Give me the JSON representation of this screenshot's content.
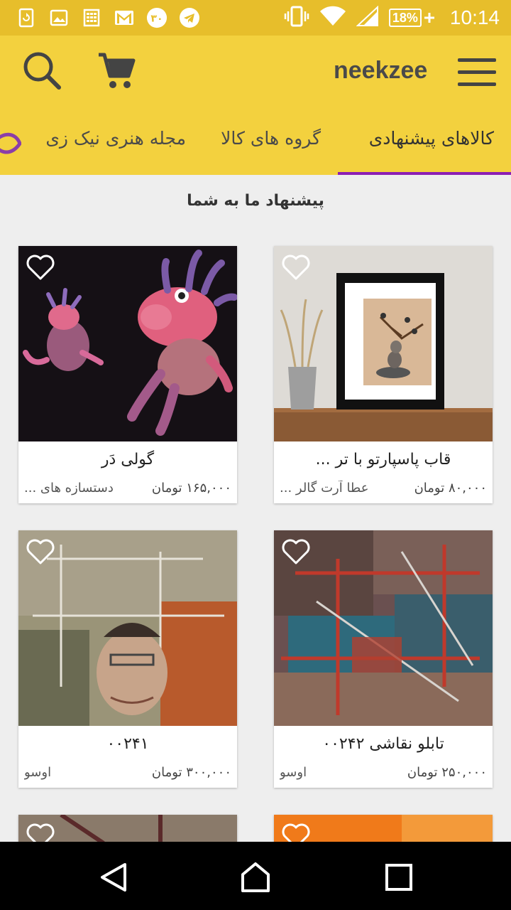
{
  "status_bar": {
    "time": "10:14",
    "battery": "18%",
    "notification_badge": "۳۰",
    "left_icons": [
      "sim-refresh-icon",
      "image-icon",
      "calculator-icon",
      "gmail-icon",
      "badge-icon",
      "telegram-icon"
    ],
    "right_icons": [
      "vibrate-icon",
      "wifi-icon",
      "signal-icon",
      "battery-icon"
    ]
  },
  "app_bar": {
    "brand": "neekzee",
    "icons": [
      "search-icon",
      "cart-icon",
      "menu-icon"
    ],
    "color": "#f3d13e"
  },
  "tabs": {
    "items": [
      {
        "label": "کالاهای پیشنهادی",
        "active": true
      },
      {
        "label": "گروه های کالا",
        "active": false
      },
      {
        "label": "مجله هنری نیک زی",
        "active": false
      }
    ],
    "active_color": "#8b1fb3"
  },
  "section_title": "پیشنهاد ما به شما",
  "products": [
    {
      "name": "قاب پاسپارتو با تر ...",
      "price": "۸۰,۰۰۰ تومان",
      "shop": "عطا آرت گالر ..."
    },
    {
      "name": "گولی دَر",
      "price": "۱۶۵,۰۰۰ تومان",
      "shop": "دستسازه های ..."
    },
    {
      "name": "تابلو نقاشی ۰۰۲۴۲",
      "price": "۲۵۰,۰۰۰ تومان",
      "shop": "اوسو"
    },
    {
      "name": "۰۰۲۴۱",
      "price": "۳۰۰,۰۰۰ تومان",
      "shop": "اوسو"
    }
  ],
  "nav_bar": {
    "icons": [
      "back-icon",
      "home-icon",
      "recents-icon"
    ]
  }
}
